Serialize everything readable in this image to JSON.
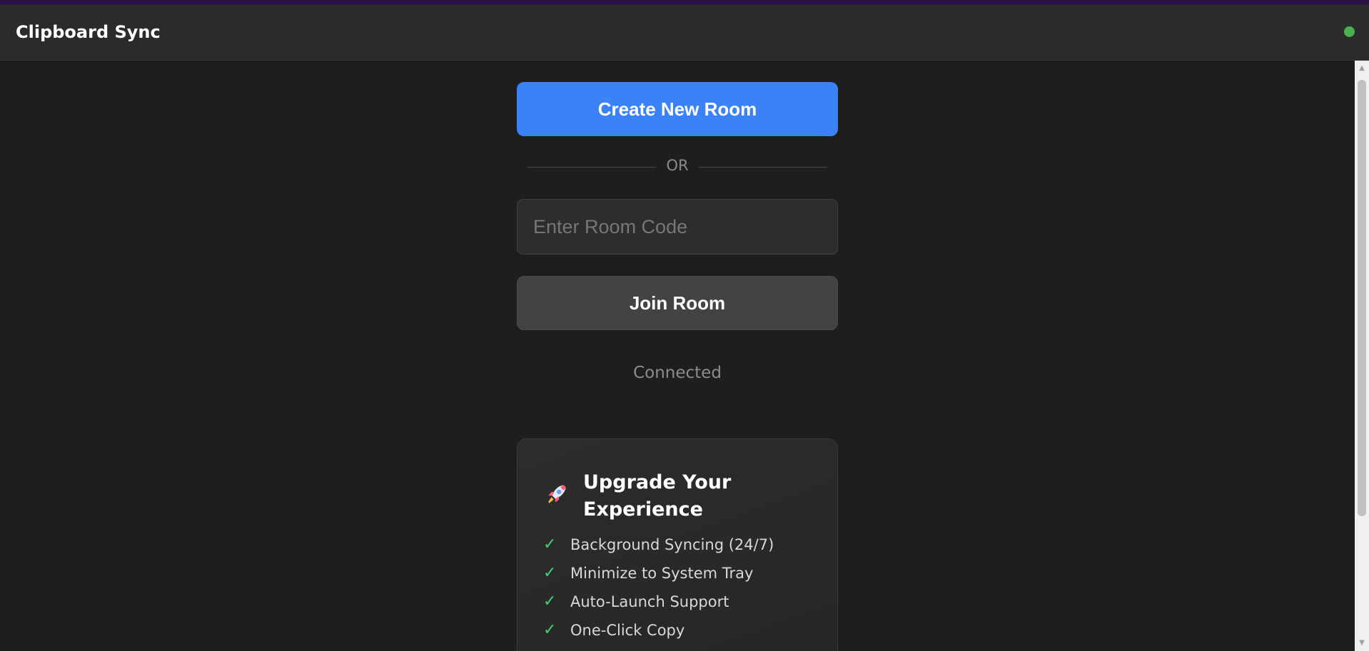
{
  "app": {
    "title": "Clipboard Sync",
    "connection_status_color": "#4caf50"
  },
  "actions": {
    "create_label": "Create New Room",
    "divider_label": "OR",
    "room_code_placeholder": "Enter Room Code",
    "room_code_value": "",
    "join_label": "Join Room"
  },
  "status": {
    "text": "Connected"
  },
  "upgrade": {
    "icon": "rocket-icon",
    "title": "Upgrade Your Experience",
    "features": [
      {
        "icon": "check-icon",
        "label": "Background Syncing (24/7)"
      },
      {
        "icon": "check-icon",
        "label": "Minimize to System Tray"
      },
      {
        "icon": "check-icon",
        "label": "Auto-Launch Support"
      },
      {
        "icon": "check-icon",
        "label": "One-Click Copy"
      }
    ]
  },
  "colors": {
    "primary_button": "#3b82f6",
    "check": "#3fd47a",
    "accent_bar": "#2a1148"
  }
}
